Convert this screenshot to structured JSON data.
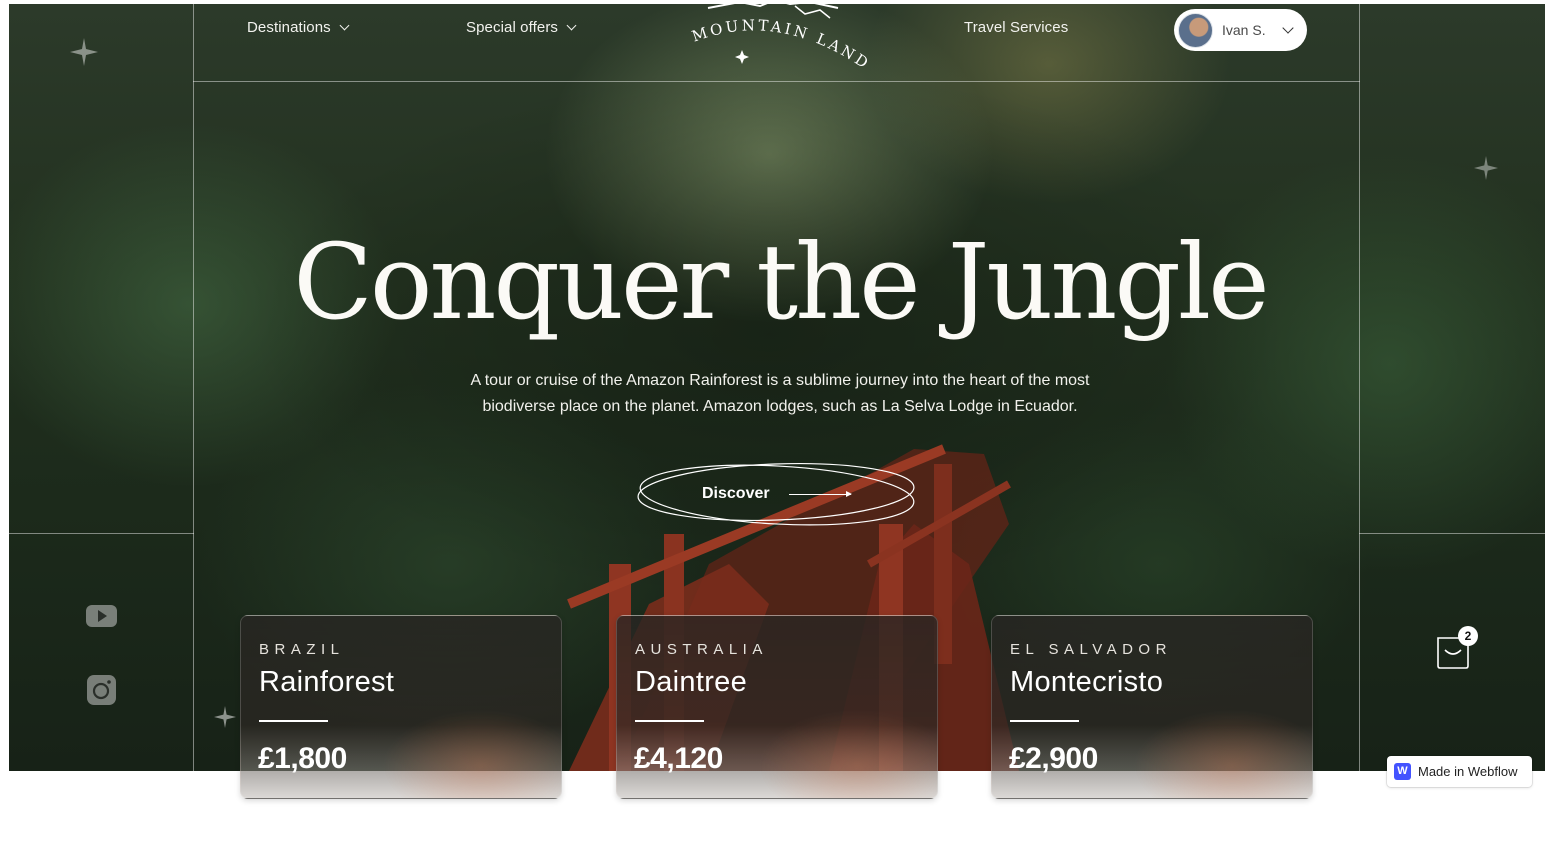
{
  "nav": {
    "destinations_label": "Destinations",
    "special_offers_label": "Special offers",
    "travel_services_label": "Travel Services",
    "logo_text": "MOUNTAIN LAND",
    "user_name": "Ivan S."
  },
  "hero": {
    "headline": "Conquer the Jungle",
    "subtext_line1": "A tour or cruise of the Amazon Rainforest is a sublime journey into the heart of the most",
    "subtext_line2": "biodiverse place on the planet. Amazon lodges, such as La Selva Lodge in Ecuador.",
    "cta_label": "Discover"
  },
  "cart": {
    "count": "2",
    "icon": "shopping-bag-icon"
  },
  "social": {
    "icons": [
      "youtube-icon",
      "instagram-icon"
    ]
  },
  "cards": [
    {
      "country": "BRAZIL",
      "place": "Rainforest",
      "price": "£1,800"
    },
    {
      "country": "AUSTRALIA",
      "place": "Daintree",
      "price": "£4,120"
    },
    {
      "country": "EL SALVADOR",
      "place": "Montecristo",
      "price": "£2,900"
    }
  ],
  "webflow_badge": {
    "label": "Made in Webflow",
    "logo_letter": "W"
  },
  "colors": {
    "accent_webflow": "#4353ff",
    "text_light": "#ffffff",
    "forest_dark": "#1c2a1b"
  }
}
